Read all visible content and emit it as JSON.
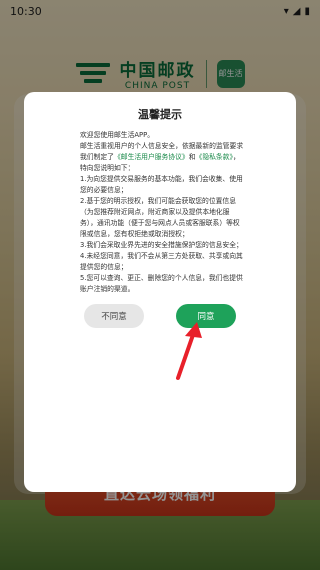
{
  "status_bar": {
    "time": "10:30",
    "icons": [
      "wifi-icon",
      "signal-icon",
      "battery-icon"
    ]
  },
  "background": {
    "logo_cn": "中国邮政",
    "logo_en": "CHINA POST",
    "app_badge": "邮生活",
    "banner_text": "直达云场领福利"
  },
  "dialog": {
    "title": "温馨提示",
    "intro_1": "欢迎您使用邮生活APP。",
    "intro_2a": "邮生活重视用户的个人信息安全，依据最新的监管要求我们制定了",
    "link_agreement": "《邮生活用户服务协议》",
    "and_text": "和",
    "link_privacy": "《隐私条款》",
    "intro_2b": "，特向您说明如下：",
    "item_1": "1.为向您提供交易服务的基本功能，我们会收集、使用您的必要信息；",
    "item_2": "2.基于您的明示授权，我们可能会获取您的位置信息（为您推荐附近网点，附近商家以及提供本地化服务），通讯功能（便于您与网点人员或客服联系）等权限或信息，您有权拒绝或取消授权；",
    "item_3": "3.我们会采取业界先进的安全措施保护您的信息安全；",
    "item_4": "4.未经您同意，我们不会从第三方处获取、共享或向其提供您的信息；",
    "item_5": "5.您可以查询、更正、删除您的个人信息，我们也提供账户注销的渠道。",
    "disagree_label": "不同意",
    "agree_label": "同意"
  },
  "colors": {
    "accent": "#1ea25a",
    "link": "#1a8a4a",
    "annotation_arrow": "#e8202a"
  }
}
